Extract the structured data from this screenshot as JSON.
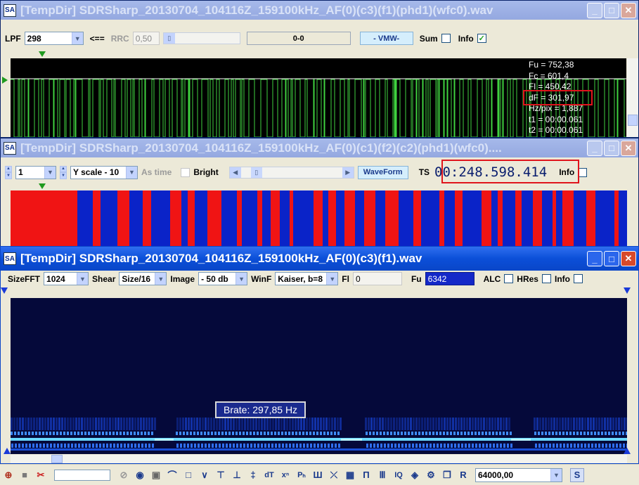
{
  "win1": {
    "title": "[TempDir] SDRSharp_20130704_104116Z_159100kHz_AF(0)(c3)(f1)(phd1)(wfc0).wav",
    "lpf_label": "LPF",
    "lpf_value": "298",
    "arrow_label": "<==",
    "rrc_label": "RRC",
    "rrc_value": "0,50",
    "range_value": "0-0",
    "mode_value": "- VMW-",
    "sum_label": "Sum",
    "info_label": "Info",
    "readouts": [
      "Fu = 752,38",
      "Fc = 601,4",
      "Fl = 450,42",
      "dF = 301,97",
      "Hz/pix = 1,887",
      "t1 = 00:00.061",
      "t2 = 00:00.061"
    ]
  },
  "win2": {
    "title": "[TempDir] SDRSharp_20130704_104116Z_159100kHz_AF(0)(c1)(f2)(c2)(phd1)(wfc0)....",
    "step_value": "1",
    "yscale_value": "Y scale - 10",
    "astime_label": "As time",
    "bright_label": "Bright",
    "waveform_label": "WaveForm",
    "ts_label": "TS",
    "ts_value": "00:248.598.414",
    "info_label": "Info"
  },
  "win3": {
    "title": "[TempDir] SDRSharp_20130704_104116Z_159100kHz_AF(0)(c3)(f1).wav",
    "sizefft_label": "SizeFFT",
    "sizefft_value": "1024",
    "shear_label": "Shear",
    "shear_value": "Size/16",
    "image_label": "Image",
    "image_value": "- 50 db",
    "winf_label": "WinF",
    "winf_value": "Kaiser, b=8",
    "fl_label": "Fl",
    "fl_value": "0",
    "fu_label": "Fu",
    "fu_value": "6342",
    "alc_label": "ALC",
    "hres_label": "HRes",
    "info_label": "Info",
    "brate_label": "Brate: 297,85 Hz"
  },
  "statusbar": {
    "rate_value": "64000,00",
    "s_label": "S"
  },
  "colors": {
    "signal_green": "#3fd23f",
    "bit_red": "#f01414",
    "bit_blue": "#0a23c8",
    "spectrogram_bg": "#05093a",
    "highlight": "#e0141c"
  }
}
